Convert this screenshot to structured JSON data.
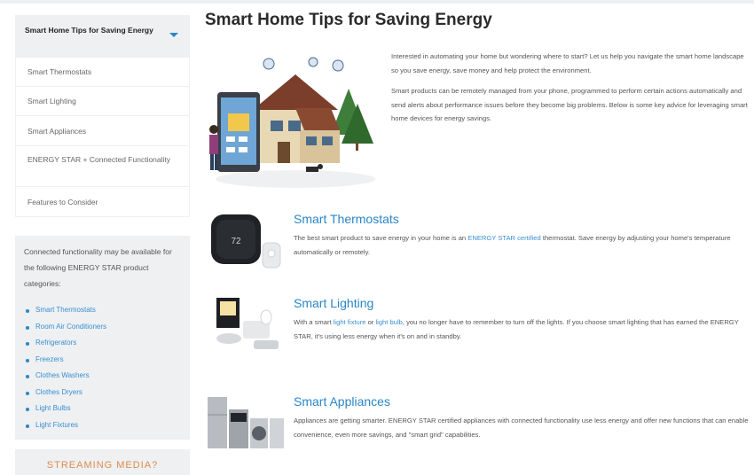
{
  "page": {
    "title": "Smart Home Tips for Saving Energy"
  },
  "sidebar": {
    "nav_heading": "Smart Home Tips for Saving Energy",
    "nav_items": [
      "Smart Thermostats",
      "Smart Lighting",
      "Smart Appliances",
      "ENERGY STAR + Connected Functionality",
      "Features to Consider"
    ],
    "categories_intro": "Connected functionality may be available for the following ENERGY STAR product categories:",
    "categories": [
      "Smart Thermostats",
      "Room Air Conditioners",
      "Refrigerators",
      "Freezers",
      "Clothes Washers",
      "Clothes Dryers",
      "Light Bulbs",
      "Light Fixtures"
    ],
    "streaming_label": "STREAMING MEDIA?"
  },
  "intro": {
    "p1": "Interested in automating your home but wondering where to start? Let us help you navigate the smart home landscape so you save energy, save money and help protect the environment.",
    "p2": "Smart products can be remotely managed from your phone, programmed to perform certain actions automatically and send alerts about performance issues before they become big problems.  Below is some key advice for leveraging smart home devices for energy savings."
  },
  "sections": [
    {
      "heading": "Smart Thermostats",
      "text_a": "The best smart product to save energy in your home is an ",
      "link_a": "ENERGY STAR certified",
      "text_b": " thermostat.  Save energy by adjusting your home's temperature automatically or remotely."
    },
    {
      "heading": "Smart Lighting",
      "text_a": "With a smart ",
      "link_a": "light fixture",
      "text_b": " or ",
      "link_b": "light bulb",
      "text_c": ", you no longer have to remember to turn off the lights.  If you choose smart lighting that has earned the ENERGY STAR, it's using less energy when it's on and in standby."
    },
    {
      "heading": "Smart Appliances",
      "text_a": "Appliances are getting smarter. ENERGY STAR certified appliances with connected functionality use less energy and offer new functions that can enable convenience, even more savings, and \"smart grid\" capabilities."
    }
  ],
  "colors": {
    "accent": "#2a86c7",
    "sidebar_bg": "#eef0f2",
    "streaming": "#e08a4a"
  }
}
